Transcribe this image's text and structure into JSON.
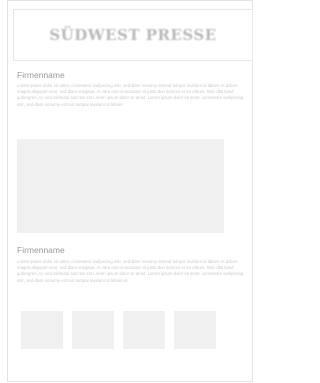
{
  "header": {
    "logo_text": "SÜDWEST PRESSE"
  },
  "sections": [
    {
      "title": "Firmenname",
      "body": "Lorem ipsum dolor sit amet, consetetur sadipscing elitr, sed diam nonumy eirmod tempor invidunt ut labore et dolore magna aliquyam erat, sed diam voluptua. At vero eos et accusam et justo duo dolores et ea rebum. Stet clita kasd gubergren, no sea takimata sanctus est Lorem ipsum dolor sit amet. Lorem ipsum dolor sit amet, consetetur sadipscing elitr, sed diam nonumy eirmod tempor invidunt ut labore"
    },
    {
      "title": "Firmenname",
      "body": "Lorem ipsum dolor sit amet, consetetur sadipscing elitr, sed diam nonumy eirmod tempor invidunt ut labore et dolore magna aliquyam erat, sed diam voluptua. At vero eos et accusam et justo duo dolores et ea rebum. Stet clita kasd gubergren, no sea takimata sanctus est Lorem ipsum dolor sit amet. Lorem ipsum dolor sit amet, consetetur sadipscing elitr, sed diam nonumy eirmod tempor invidunt ut labore et"
    }
  ],
  "colors": {
    "placeholder_fill": "#f0f0f0",
    "border": "#e4e4e4",
    "heading_text": "#9a9a9a",
    "body_text": "#c9c9c9"
  }
}
